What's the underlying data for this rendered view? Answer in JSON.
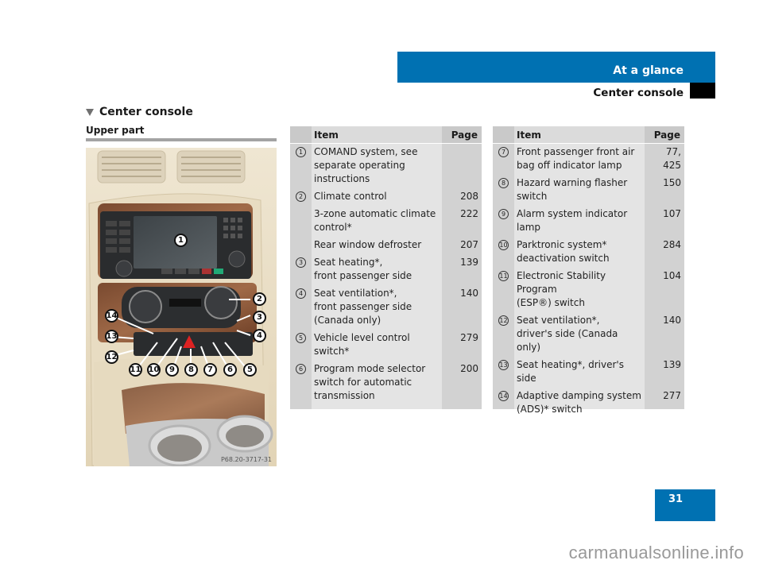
{
  "header": {
    "chapter": "At a glance",
    "section": "Center console"
  },
  "content": {
    "section_title": "Center console",
    "subsection_title": "Upper part",
    "figure_code": "P68.20-3717-31",
    "callouts": [
      "1",
      "2",
      "3",
      "4",
      "5",
      "6",
      "7",
      "8",
      "9",
      "10",
      "11",
      "12",
      "13",
      "14"
    ]
  },
  "tables": {
    "left": {
      "header_item": "Item",
      "header_page": "Page",
      "rows": [
        {
          "num": "1",
          "item": "COMAND system, see\nseparate operating\ninstructions",
          "page": ""
        },
        {
          "num": "2",
          "item": "Climate control",
          "page": "208"
        },
        {
          "num": "",
          "item": "3-zone automatic climate\ncontrol*",
          "page": "222"
        },
        {
          "num": "",
          "item": "Rear window defroster",
          "page": "207"
        },
        {
          "num": "3",
          "item": "Seat heating*,\nfront passenger side",
          "page": "139"
        },
        {
          "num": "4",
          "item": "Seat ventilation*,\nfront passenger side\n(Canada only)",
          "page": "140"
        },
        {
          "num": "5",
          "item": "Vehicle level control\nswitch*",
          "page": "279"
        },
        {
          "num": "6",
          "item": "Program mode selector\nswitch for automatic\ntransmission",
          "page": "200"
        }
      ]
    },
    "right": {
      "header_item": "Item",
      "header_page": "Page",
      "rows": [
        {
          "num": "7",
          "item": "Front passenger front air\nbag off indicator lamp",
          "page": "77,\n425"
        },
        {
          "num": "8",
          "item": "Hazard warning flasher\nswitch",
          "page": "150"
        },
        {
          "num": "9",
          "item": "Alarm system indicator\nlamp",
          "page": "107"
        },
        {
          "num": "10",
          "item": "Parktronic system*\ndeactivation switch",
          "page": "284"
        },
        {
          "num": "11",
          "item": "Electronic Stability Program\n(ESP®) switch",
          "page": "104"
        },
        {
          "num": "12",
          "item": "Seat ventilation*,\ndriver's side (Canada only)",
          "page": "140"
        },
        {
          "num": "13",
          "item": "Seat heating*, driver's side",
          "page": "139"
        },
        {
          "num": "14",
          "item": "Adaptive damping system\n(ADS)* switch",
          "page": "277"
        }
      ]
    }
  },
  "footer": {
    "page_number": "31",
    "watermark": "carmanualsonline.info"
  },
  "colors": {
    "brand_blue": "#0071b2",
    "table_dark": "#d2d2d2",
    "table_light": "#e4e4e4"
  }
}
